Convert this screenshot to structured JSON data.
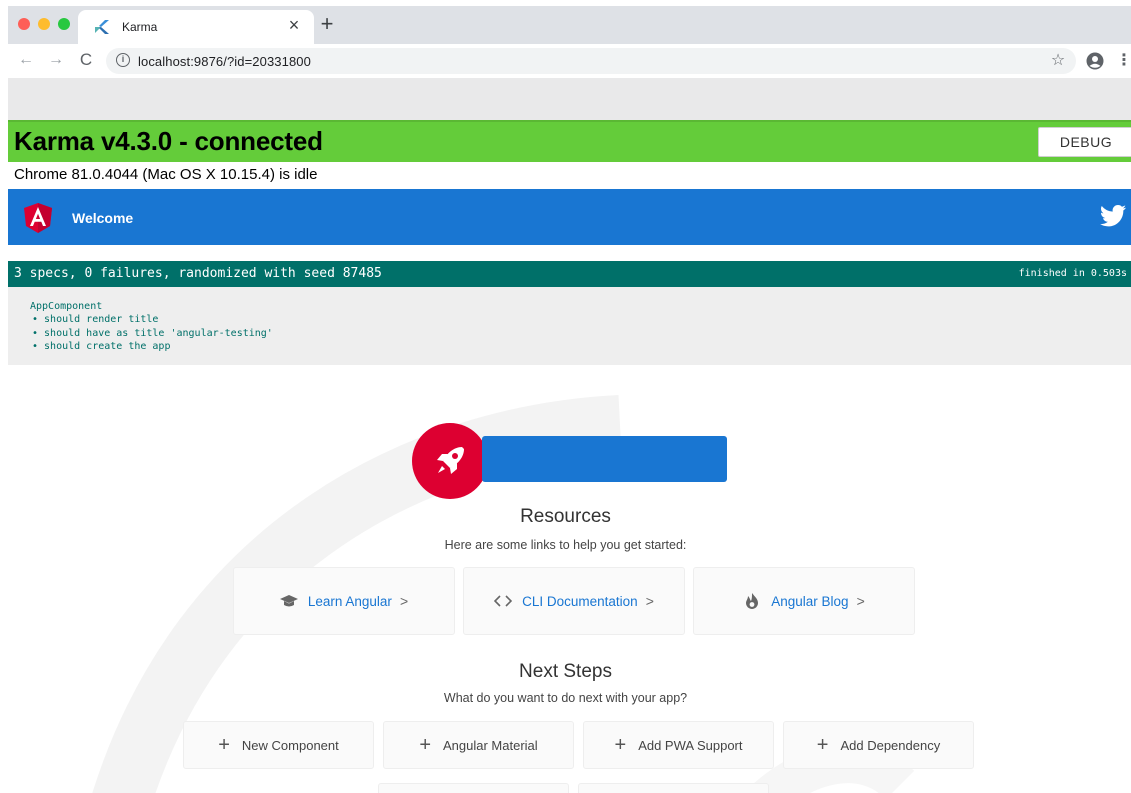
{
  "browser": {
    "tab_title": "Karma",
    "tab_close": "×",
    "new_tab": "+",
    "url": "localhost:9876/?id=20331800",
    "back": "←",
    "forward": "→",
    "reload": "C",
    "bookmark": "☆",
    "menu": "⋮",
    "info": "i"
  },
  "karma": {
    "title": "Karma v4.3.0 - connected",
    "debug_label": "DEBUG",
    "browser_status": "Chrome 81.0.4044 (Mac OS X 10.15.4) is idle"
  },
  "app_header": {
    "welcome": "Welcome"
  },
  "jasmine": {
    "summary": "3 specs, 0 failures, randomized with seed 87485",
    "duration": "finished in 0.503s",
    "suite": "AppComponent",
    "specs": [
      "should render title",
      "should have as title 'angular-testing'",
      "should create the app"
    ]
  },
  "resources": {
    "title": "Resources",
    "subtitle": "Here are some links to help you get started:",
    "cards": [
      {
        "label": "Learn Angular",
        "icon": "graduation-cap-icon"
      },
      {
        "label": "CLI Documentation",
        "icon": "code-brackets-icon"
      },
      {
        "label": "Angular Blog",
        "icon": "flame-icon"
      }
    ],
    "chevron": ">"
  },
  "next_steps": {
    "title": "Next Steps",
    "subtitle": "What do you want to do next with your app?",
    "plus": "+",
    "items": [
      {
        "label": "New Component"
      },
      {
        "label": "Angular Material"
      },
      {
        "label": "Add PWA Support"
      },
      {
        "label": "Add Dependency"
      }
    ]
  },
  "colors": {
    "karma_green": "#64cc3a",
    "angular_blue": "#1976d2",
    "angular_red": "#dd0031",
    "jasmine_teal": "#007069"
  }
}
